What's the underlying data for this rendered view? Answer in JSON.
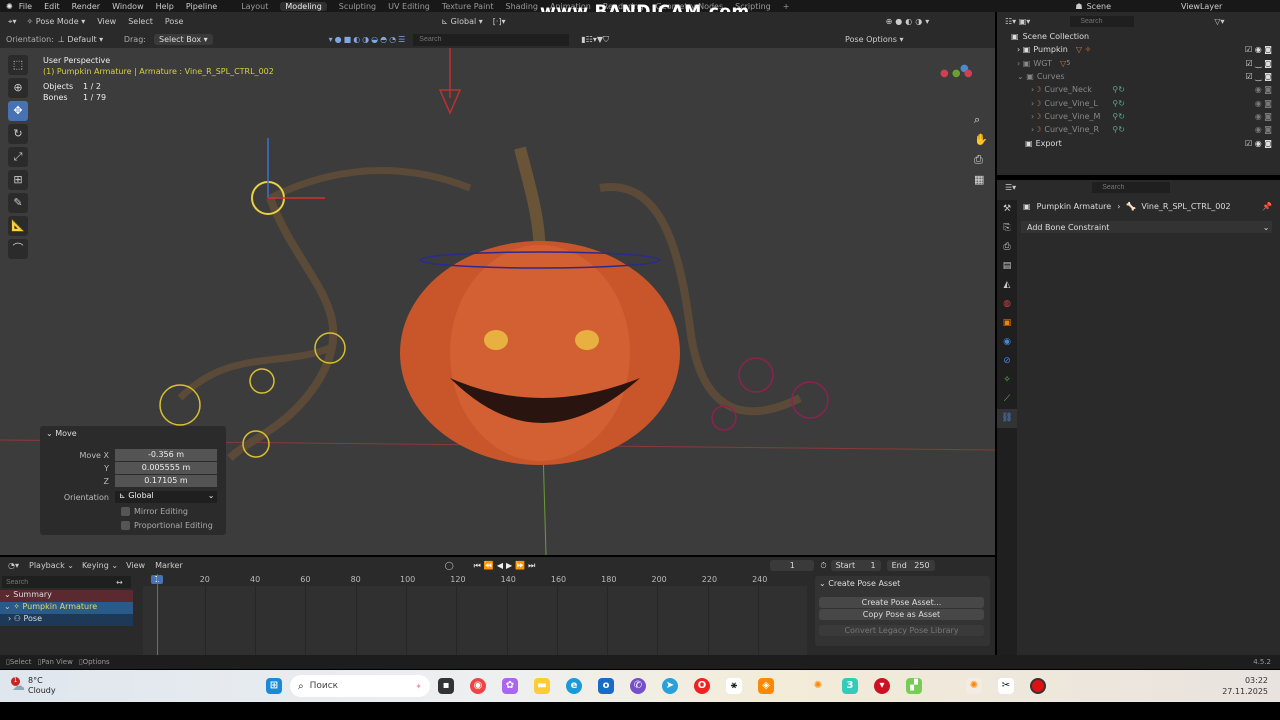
{
  "topbar": {
    "menus": [
      "File",
      "Edit",
      "Render",
      "Window",
      "Help",
      "Pipeline"
    ],
    "workspaces": [
      "Layout",
      "Modeling",
      "Sculpting",
      "UV Editing",
      "Texture Paint",
      "Shading",
      "Animation",
      "Rendering",
      "Geometry Nodes",
      "Scripting"
    ],
    "active_workspace": "Modeling",
    "scene": "Scene",
    "view_layer": "ViewLayer",
    "watermark": "www.BANDICAM.com"
  },
  "viewport_header": {
    "mode": "Pose Mode",
    "menus": [
      "View",
      "Select",
      "Pose"
    ],
    "transform_orientation": "Global"
  },
  "tool_header": {
    "orientation_label": "Orientation:",
    "orientation_value": "Default",
    "drag_label": "Drag:",
    "drag_value": "Select Box",
    "search_placeholder": "Search",
    "pose_options": "Pose Options"
  },
  "overlay": {
    "view_name": "User Perspective",
    "context": "(1) Pumpkin Armature | Armature : Vine_R_SPL_CTRL_002",
    "objects_label": "Objects",
    "objects_value": "1 / 2",
    "bones_label": "Bones",
    "bones_value": "1 / 79"
  },
  "move_panel": {
    "title": "Move",
    "move_x_label": "Move X",
    "move_x": "-0.356 m",
    "y_label": "Y",
    "y": "0.005555 m",
    "z_label": "Z",
    "z": "0.17105 m",
    "orientation_label": "Orientation",
    "orientation": "Global",
    "mirror": "Mirror Editing",
    "proportional": "Proportional Editing"
  },
  "outliner": {
    "search_placeholder": "Search",
    "root": "Scene Collection",
    "items": [
      {
        "name": "Pumpkin",
        "level": 1
      },
      {
        "name": "WGT",
        "level": 1,
        "badge": "5"
      },
      {
        "name": "Curves",
        "level": 1
      },
      {
        "name": "Curve_Neck",
        "level": 2
      },
      {
        "name": "Curve_Vine_L",
        "level": 2
      },
      {
        "name": "Curve_Vine_M",
        "level": 2
      },
      {
        "name": "Curve_Vine_R",
        "level": 2
      },
      {
        "name": "Export",
        "level": 1
      }
    ]
  },
  "properties": {
    "search_placeholder": "Search",
    "breadcrumb_object": "Pumpkin Armature",
    "breadcrumb_bone": "Vine_R_SPL_CTRL_002",
    "add_constraint": "Add Bone Constraint"
  },
  "timeline": {
    "menus": [
      "Playback",
      "Keying",
      "View",
      "Marker"
    ],
    "current_frame": "1",
    "start_label": "Start",
    "start": "1",
    "end_label": "End",
    "end": "250",
    "search_placeholder": "Search",
    "ticks": [
      "1",
      "20",
      "40",
      "60",
      "80",
      "100",
      "120",
      "140",
      "160",
      "180",
      "200",
      "220",
      "240"
    ],
    "channels": [
      "Summary",
      "Pumpkin Armature",
      "Pose"
    ],
    "pose_asset": {
      "title": "Create Pose Asset",
      "create": "Create Pose Asset...",
      "copy": "Copy Pose as Asset",
      "convert": "Convert Legacy Pose Library"
    }
  },
  "status": {
    "select": "Select",
    "pan": "Pan View",
    "options": "Options",
    "version": "4.5.2"
  },
  "taskbar": {
    "temp": "8°C",
    "weather": "Cloudy",
    "weather_badge": "1",
    "search": "Поиск",
    "time": "03:22",
    "date": "27.11.2025"
  }
}
